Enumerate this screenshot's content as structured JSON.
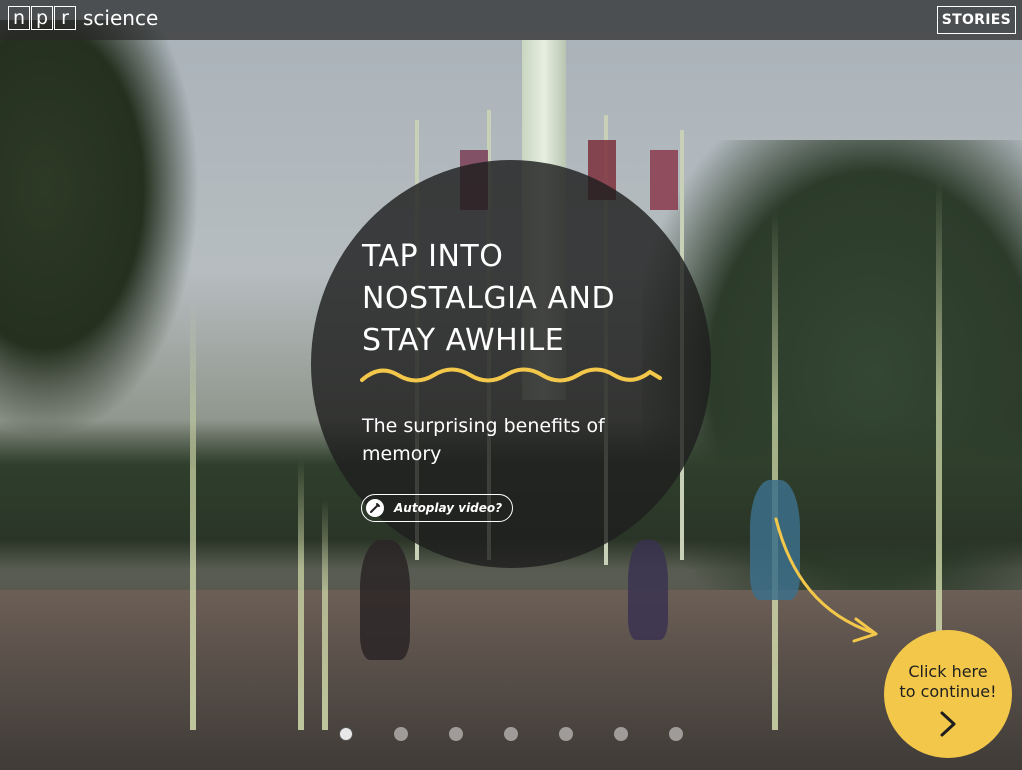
{
  "header": {
    "logo_letters": [
      "n",
      "p",
      "r"
    ],
    "section": "science",
    "stories_label": "STORIES"
  },
  "hero": {
    "headline": [
      "TAP INTO",
      "NOSTALGIA AND",
      "STAY AWHILE"
    ],
    "subtitle": "The surprising benefits of memory",
    "autoplay_label": "Autoplay video?"
  },
  "continue": {
    "line1": "Click here",
    "line2": "to continue!"
  },
  "pagination": {
    "total": 7,
    "active_index": 0
  },
  "colors": {
    "accent_yellow": "#f3c84a",
    "circle_bg": "#1e1e1e",
    "topbar_bg": "#282828"
  },
  "icons": {
    "autoplay": "pencil-slash-icon",
    "continue": "chevron-right-icon",
    "arrow": "curved-arrow-icon"
  }
}
